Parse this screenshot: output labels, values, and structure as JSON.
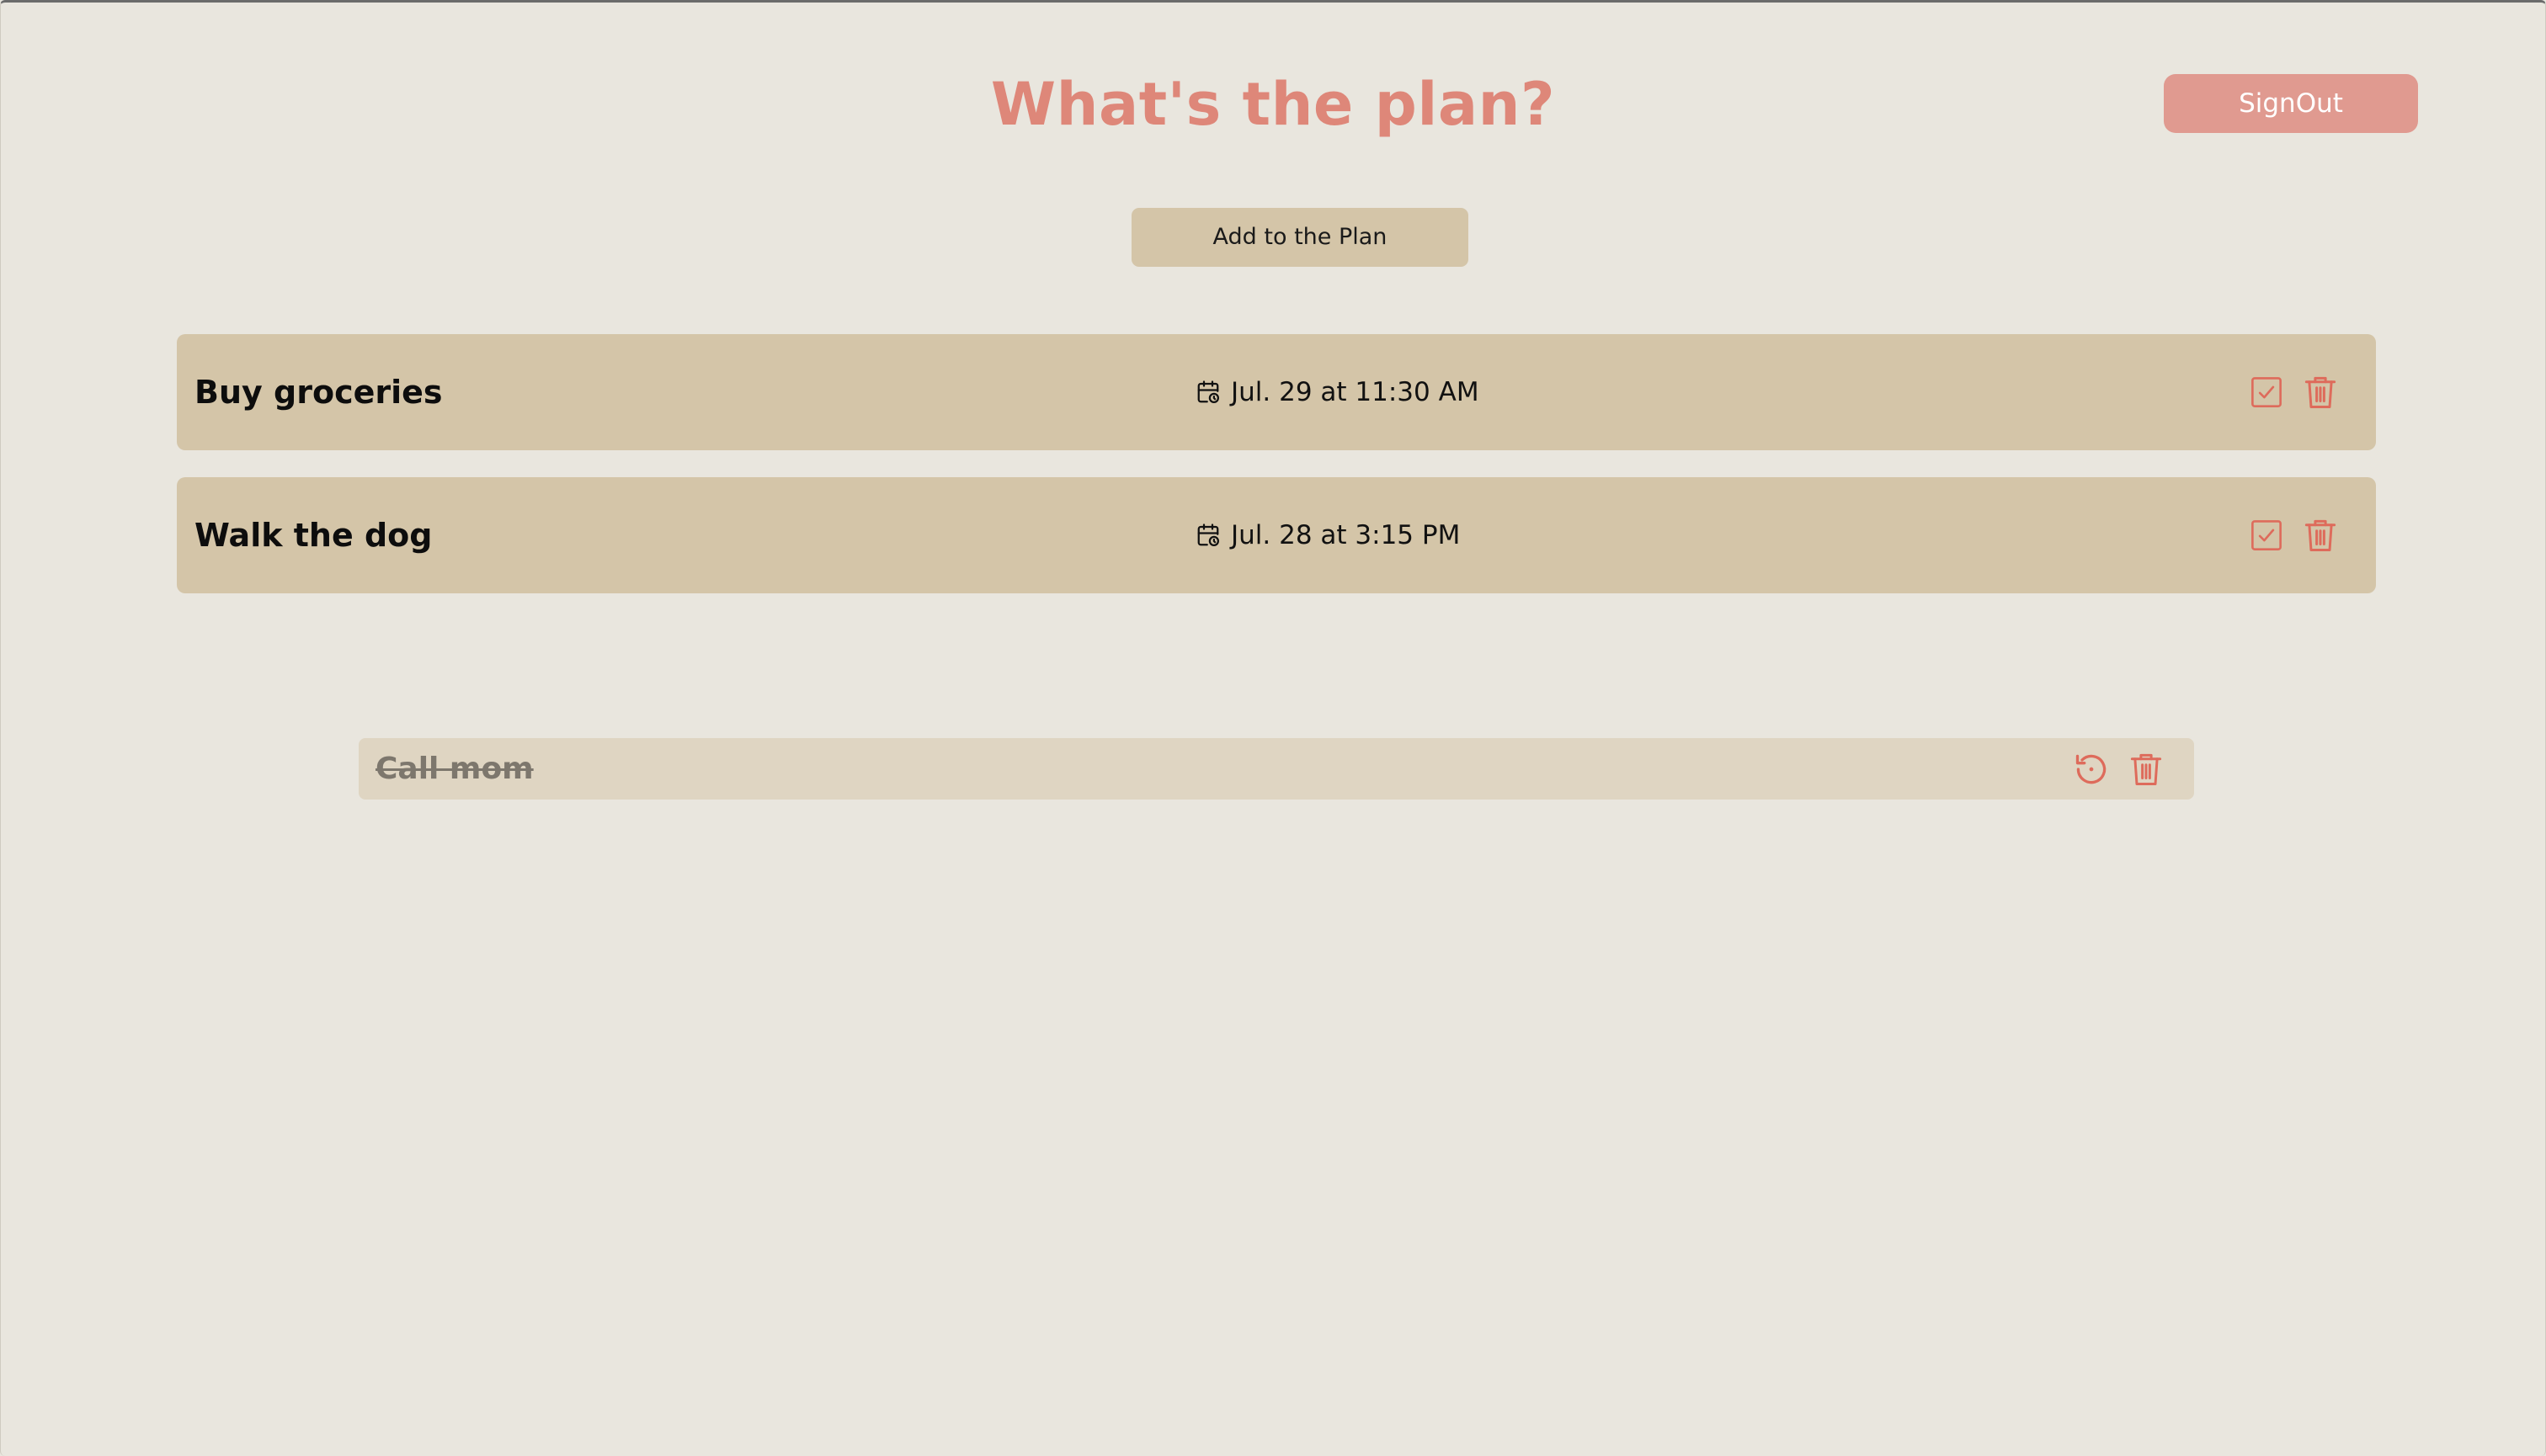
{
  "header": {
    "title": "What's the plan?",
    "signout_label": "SignOut"
  },
  "toolbar": {
    "add_label": "Add to the Plan"
  },
  "tasks": [
    {
      "title": "Buy groceries",
      "date": "Jul. 29 at 11:30 AM"
    },
    {
      "title": "Walk the dog",
      "date": "Jul. 28 at 3:15 PM"
    }
  ],
  "completed": [
    {
      "title": "Call mom"
    }
  ],
  "icons": {
    "date": "calendar-clock-icon",
    "complete": "checkbox-check-icon",
    "delete": "trash-icon",
    "restore": "restore-icon"
  },
  "colors": {
    "background": "#e9e6de",
    "accent": "#de8779",
    "signout_button": "#e09a90",
    "card": "#d4c5a8",
    "completed_card": "#dfd5c2",
    "icon": "#de6b5b"
  }
}
